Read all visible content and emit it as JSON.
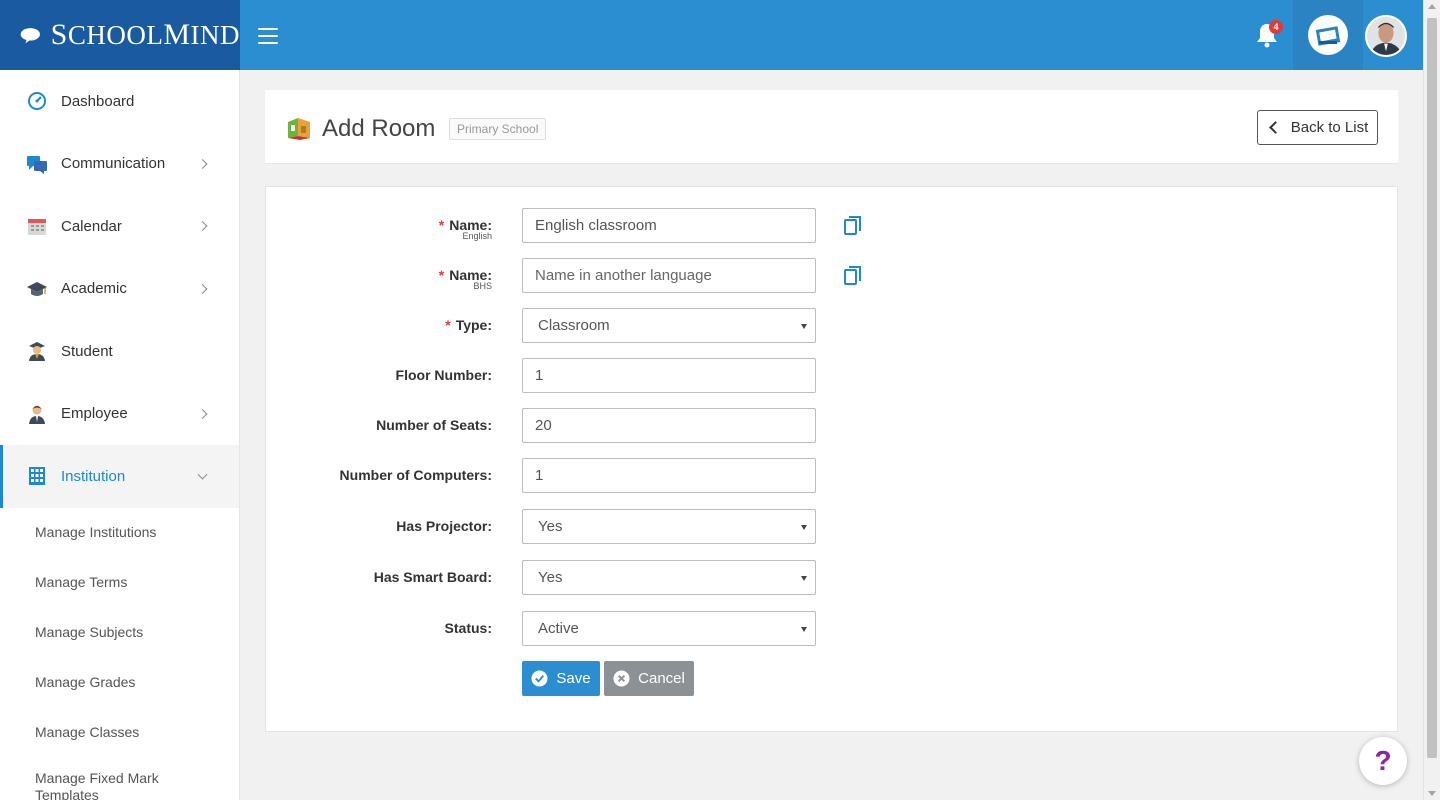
{
  "brand": {
    "name_prefix": "S",
    "name_part1": "CHOOL",
    "name_prefix2": "M",
    "name_part2": "IND"
  },
  "topbar": {
    "notification_count": "4"
  },
  "sidebar": {
    "items": [
      {
        "label": "Dashboard",
        "icon": "dashboard-icon"
      },
      {
        "label": "Communication",
        "icon": "chat-icon"
      },
      {
        "label": "Calendar",
        "icon": "calendar-icon"
      },
      {
        "label": "Academic",
        "icon": "graduation-cap-icon"
      },
      {
        "label": "Student",
        "icon": "student-icon"
      },
      {
        "label": "Employee",
        "icon": "employee-icon"
      },
      {
        "label": "Institution",
        "icon": "building-icon"
      }
    ],
    "subitems": [
      "Manage Institutions",
      "Manage Terms",
      "Manage Subjects",
      "Manage Grades",
      "Manage Classes",
      "Manage Fixed Mark Templates"
    ]
  },
  "page": {
    "title": "Add Room",
    "tag": "Primary School",
    "back_label": "Back to List"
  },
  "form": {
    "name_en": {
      "label": "Name:",
      "sub": "English",
      "value": "English classroom"
    },
    "name_bhs": {
      "label": "Name:",
      "sub": "BHS",
      "placeholder": "Name in another language"
    },
    "type": {
      "label": "Type:",
      "value": "Classroom"
    },
    "floor": {
      "label": "Floor Number:",
      "value": "1"
    },
    "seats": {
      "label": "Number of Seats:",
      "value": "20"
    },
    "computers": {
      "label": "Number of Computers:",
      "value": "1"
    },
    "projector": {
      "label": "Has Projector:",
      "value": "Yes"
    },
    "smartboard": {
      "label": "Has Smart Board:",
      "value": "Yes"
    },
    "status": {
      "label": "Status:",
      "value": "Active"
    },
    "required_mark": "*",
    "save_label": "Save",
    "cancel_label": "Cancel"
  },
  "help": {
    "label": "?"
  },
  "colors": {
    "primary": "#2b8ed0",
    "brand_dark": "#1a5aa0",
    "required": "#e53935",
    "cancel": "#8c9196",
    "help": "#8e24aa"
  }
}
